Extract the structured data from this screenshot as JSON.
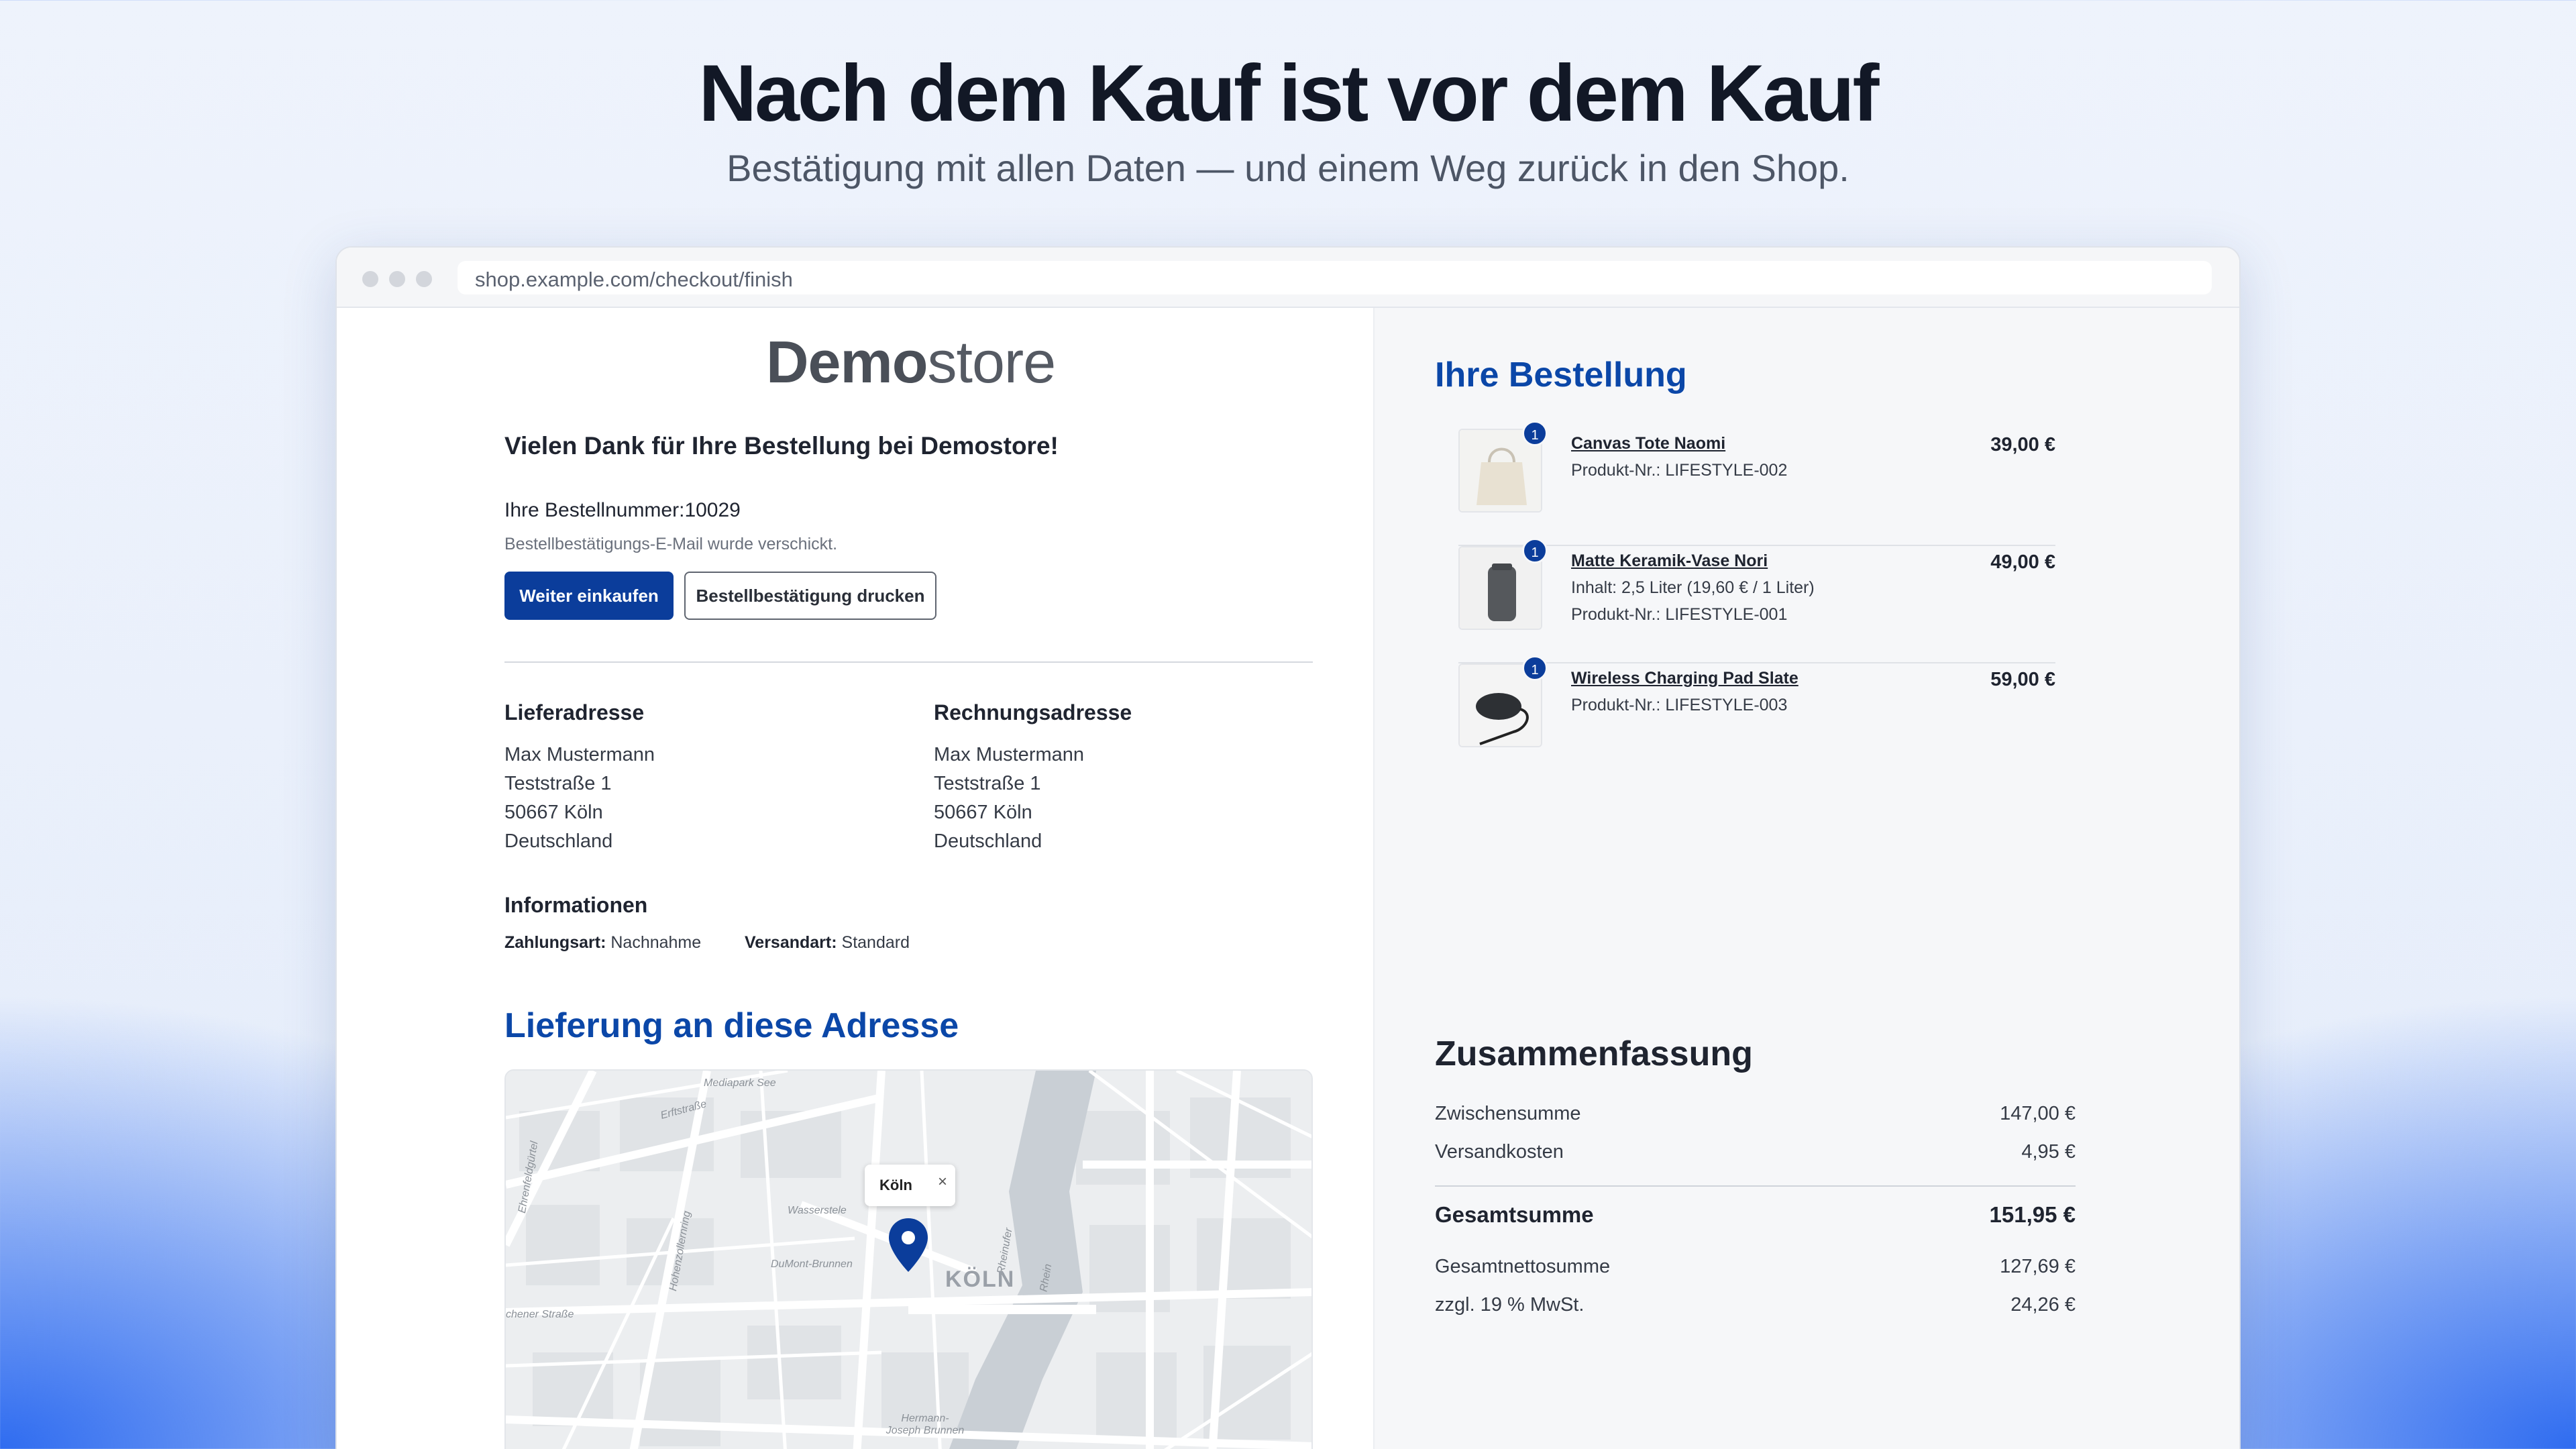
{
  "hero": {
    "title": "Nach dem Kauf ist vor dem Kauf",
    "subtitle": "Bestätigung mit allen Daten — und einem Weg zurück in den Shop."
  },
  "browser": {
    "url": "shop.example.com/checkout/finish"
  },
  "logo": {
    "bold": "Demo",
    "light": "store"
  },
  "confirmation": {
    "thanks": "Vielen Dank für Ihre Bestellung bei Demostore!",
    "order_number_label": "Ihre Bestellnummer:",
    "order_number": "10029",
    "mail_sent": "Bestellbestätigungs-E-Mail wurde verschickt.",
    "continue_button": "Weiter einkaufen",
    "print_button": "Bestellbestätigung drucken"
  },
  "shipping_address": {
    "title": "Lieferadresse",
    "lines": [
      "Max Mustermann",
      "Teststraße 1",
      "50667 Köln",
      "Deutschland"
    ]
  },
  "billing_address": {
    "title": "Rechnungsadresse",
    "lines": [
      "Max Mustermann",
      "Teststraße 1",
      "50667 Köln",
      "Deutschland"
    ]
  },
  "information": {
    "title": "Informationen",
    "payment_label": "Zahlungsart:",
    "payment_value": "Nachnahme",
    "shipping_label": "Versandart:",
    "shipping_value": "Standard"
  },
  "delivery": {
    "title": "Lieferung an diese Adresse",
    "popup_label": "Köln",
    "popup_close": "×",
    "city_label": "KÖLN",
    "street_labels": [
      "Mediapark See",
      "Erftstraße",
      "Wasserstele",
      "DuMont-Brunnen",
      "Ehrenfeldgürtel",
      "chener Straße",
      "Hohenzollernring",
      "Hermann-Joseph Brunnen",
      "Rheinufer",
      "Rhein"
    ]
  },
  "order": {
    "title": "Ihre Bestellung",
    "items": [
      {
        "qty": "1",
        "name": "Canvas Tote Naomi",
        "lines": [
          "Produkt-Nr.: LIFESTYLE-002"
        ],
        "price": "39,00 €"
      },
      {
        "qty": "1",
        "name": "Matte Keramik-Vase Nori",
        "lines": [
          "Inhalt: 2,5 Liter (19,60 € / 1 Liter)",
          "Produkt-Nr.: LIFESTYLE-001"
        ],
        "price": "49,00 €"
      },
      {
        "qty": "1",
        "name": "Wireless Charging Pad Slate",
        "lines": [
          "Produkt-Nr.: LIFESTYLE-003"
        ],
        "price": "59,00 €"
      }
    ]
  },
  "summary": {
    "title": "Zusammenfassung",
    "subtotal_label": "Zwischensumme",
    "subtotal": "147,00 €",
    "shipping_label": "Versandkosten",
    "shipping": "4,95 €",
    "total_label": "Gesamtsumme",
    "total": "151,95 €",
    "net_label": "Gesamtnettosumme",
    "net": "127,69 €",
    "vat_label": "zzgl. 19 % MwSt.",
    "vat": "24,26 €"
  },
  "colors": {
    "accent": "#0b3d9b",
    "heading_blue": "#0b47a8"
  }
}
